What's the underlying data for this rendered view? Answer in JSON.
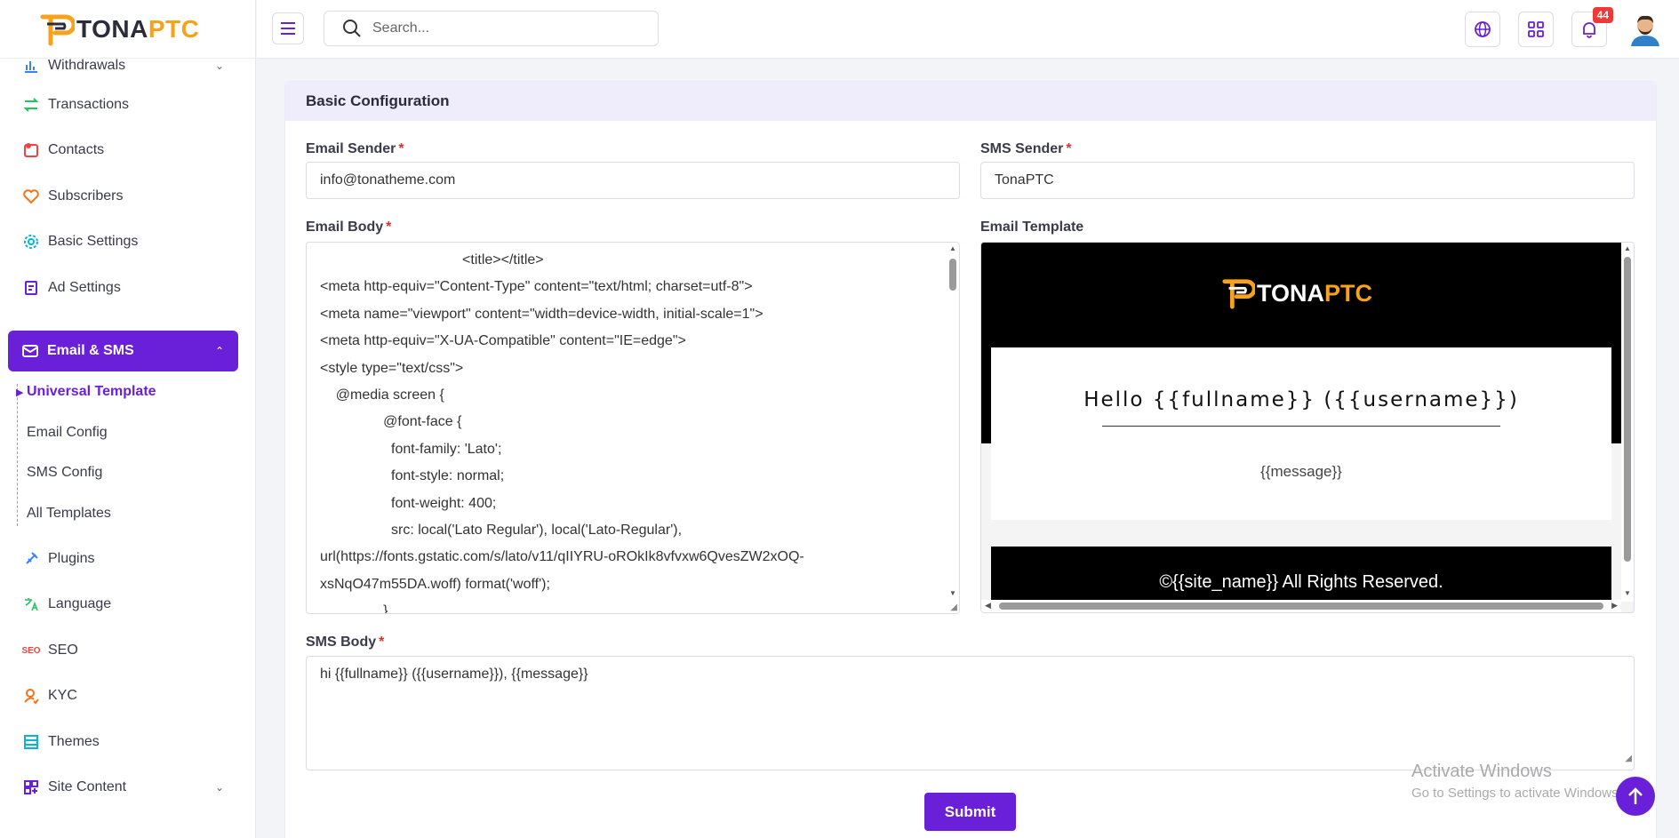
{
  "brand": {
    "part1": "TONA",
    "part2": "PTC",
    "accent": "#f7a21b",
    "primary": "#6a1fd8"
  },
  "header": {
    "search_placeholder": "Search...",
    "notification_count": "44"
  },
  "sidebar": {
    "items": [
      {
        "label": "Withdrawals",
        "icon": "chart-icon"
      },
      {
        "label": "Transactions",
        "icon": "transfer-icon"
      },
      {
        "label": "Contacts",
        "icon": "contacts-icon"
      },
      {
        "label": "Subscribers",
        "icon": "heart-icon"
      },
      {
        "label": "Basic Settings",
        "icon": "gear-icon"
      },
      {
        "label": "Ad Settings",
        "icon": "clipboard-icon"
      },
      {
        "label": "Email & SMS",
        "icon": "mail-icon"
      },
      {
        "label": "Plugins",
        "icon": "plug-icon"
      },
      {
        "label": "Language",
        "icon": "translate-icon"
      },
      {
        "label": "SEO",
        "icon": "seo-icon"
      },
      {
        "label": "KYC",
        "icon": "user-check-icon"
      },
      {
        "label": "Themes",
        "icon": "layout-icon"
      },
      {
        "label": "Site Content",
        "icon": "grid-plus-icon"
      }
    ],
    "sub_items": [
      "Universal Template",
      "Email Config",
      "SMS Config",
      "All Templates"
    ]
  },
  "form": {
    "section_title": "Basic Configuration",
    "email_sender_label": "Email Sender",
    "email_sender_value": "info@tonatheme.com",
    "sms_sender_label": "SMS Sender",
    "sms_sender_value": "TonaPTC",
    "email_body_label": "Email Body",
    "email_body_lines": [
      "                                    <title></title>",
      "<meta http-equiv=\"Content-Type\" content=\"text/html; charset=utf-8\">",
      "<meta name=\"viewport\" content=\"width=device-width, initial-scale=1\">",
      "<meta http-equiv=\"X-UA-Compatible\" content=\"IE=edge\">",
      "<style type=\"text/css\">",
      "    @media screen {",
      "                @font-face {",
      "                  font-family: 'Lato';",
      "                  font-style: normal;",
      "                  font-weight: 400;",
      "                  src: local('Lato Regular'), local('Lato-Regular'),",
      "url(https://fonts.gstatic.com/s/lato/v11/qIIYRU-oROkIk8vfvxw6QvesZW2xOQ-",
      "xsNqO47m55DA.woff) format('woff');",
      "                }"
    ],
    "email_template_label": "Email Template",
    "template_hello": "Hello {{fullname}} ({{username}})",
    "template_message": "{{message}}",
    "template_footer": "©{{site_name}} All Rights Reserved.",
    "sms_body_label": "SMS Body",
    "sms_body_value": "hi {{fullname}} ({{username}}), {{message}}",
    "submit_label": "Submit",
    "required_mark": "*"
  },
  "watermark": {
    "line1": "Activate Windows",
    "line2": "Go to Settings to activate Windows."
  }
}
